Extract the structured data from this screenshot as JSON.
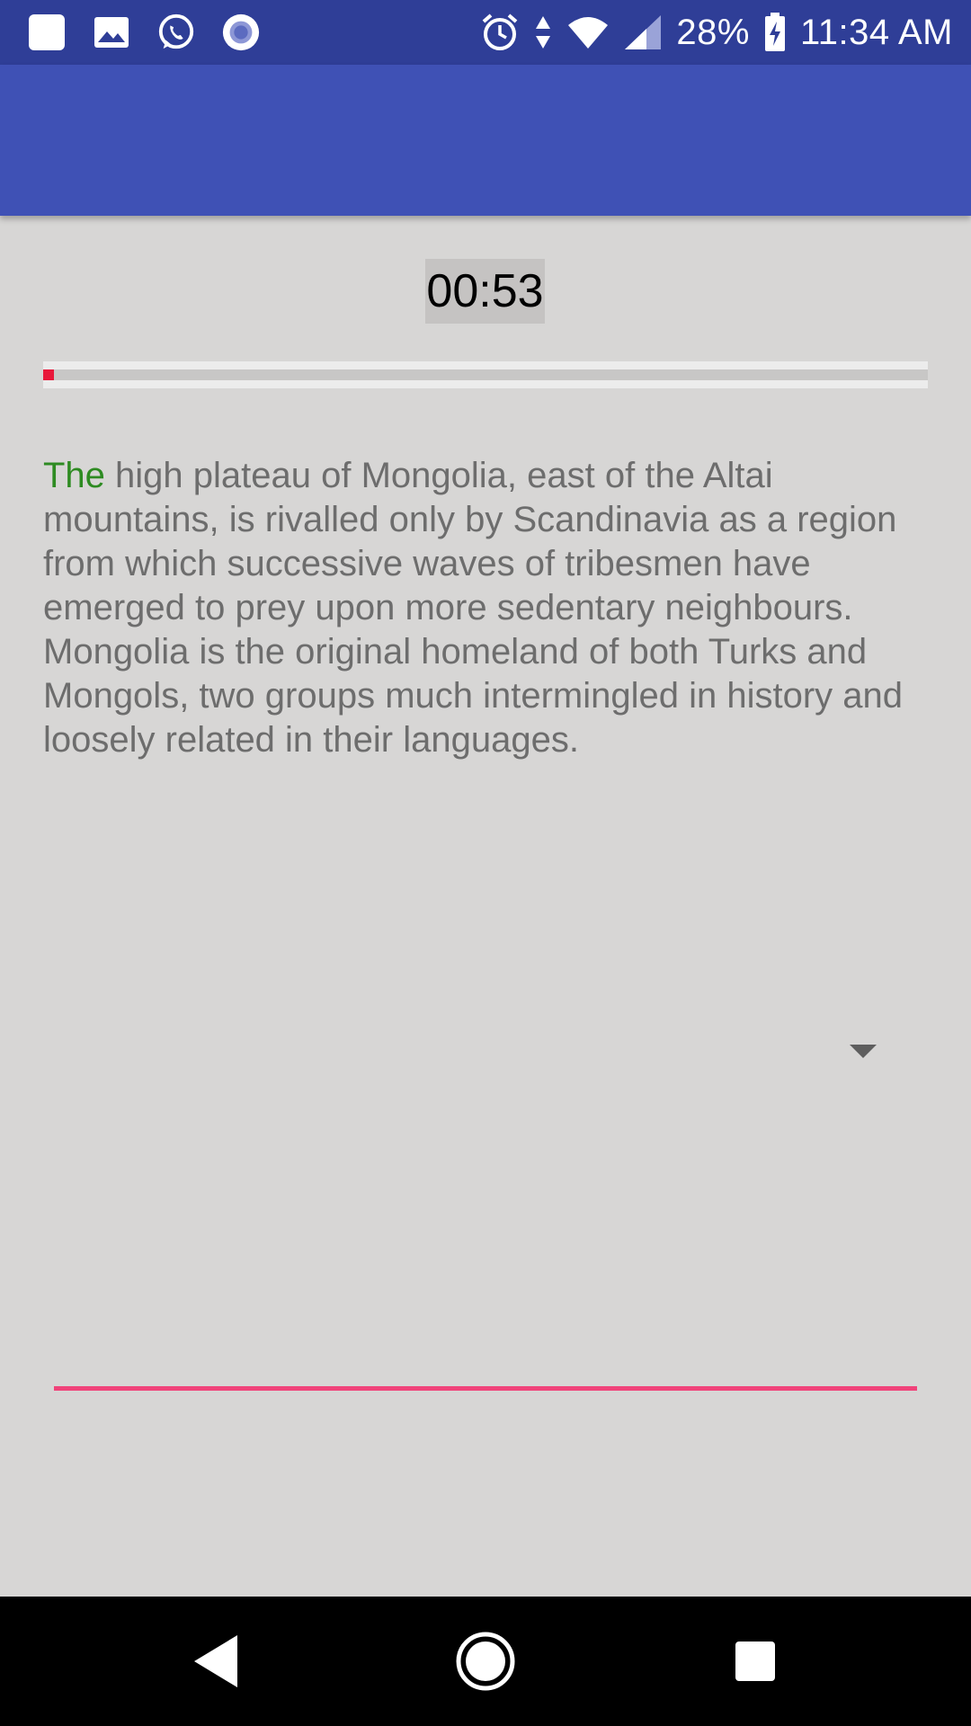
{
  "status_bar": {
    "battery": "28%",
    "time": "11:34 AM",
    "icons": [
      "notification-square-icon",
      "gallery-icon",
      "whatsapp-icon",
      "record-icon",
      "alarm-icon",
      "data-arrows-icon",
      "wifi-icon",
      "signal-icon",
      "battery-charging-icon"
    ]
  },
  "timer": {
    "value": "00:53"
  },
  "progress": {
    "fraction": 0.012,
    "fill_color": "#e8183a"
  },
  "passage": {
    "highlight": "The",
    "rest": " high plateau of Mongolia, east of the Altai mountains, is rivalled only by Scandinavia as a region from which successive waves of tribesmen have emerged to prey upon more sedentary neighbours. Mongolia is the original homeland of both Turks and Mongols, two groups much intermingled in history and loosely related in their languages."
  },
  "colors": {
    "status_bar": "#2f3e97",
    "app_bar": "#3f51b5",
    "background": "#d7d6d5",
    "highlight_text": "#2e8b22",
    "body_text": "#6d6d6d",
    "input_underline": "#f0437a"
  },
  "nav": {
    "icons": [
      "back-icon",
      "home-icon",
      "recents-icon"
    ]
  }
}
